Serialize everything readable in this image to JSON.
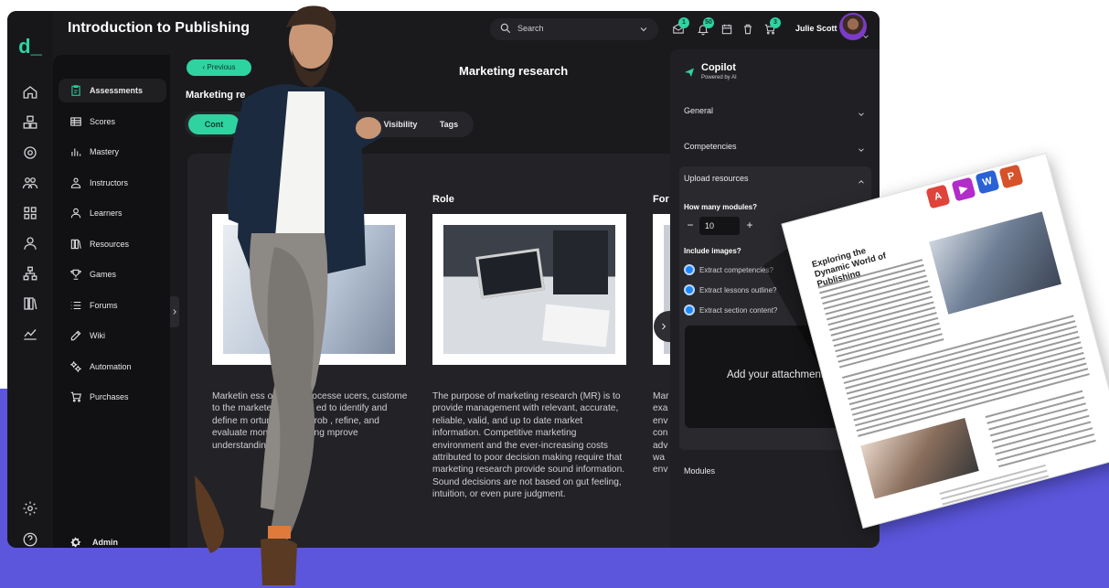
{
  "app": {
    "title": "Introduction to Publishing",
    "logo_glyph": "d_"
  },
  "topbar": {
    "search_placeholder": "Search",
    "badges": {
      "messages": "1",
      "notifications": "50",
      "cart": "3"
    },
    "user_name": "Julie Scott"
  },
  "sidebar": {
    "items": [
      {
        "label": "Assessments",
        "icon": "clipboard-icon",
        "active": true
      },
      {
        "label": "Scores",
        "icon": "table-icon"
      },
      {
        "label": "Mastery",
        "icon": "bar-chart-icon"
      },
      {
        "label": "Instructors",
        "icon": "instructor-icon"
      },
      {
        "label": "Learners",
        "icon": "person-icon"
      },
      {
        "label": "Resources",
        "icon": "books-icon"
      },
      {
        "label": "Games",
        "icon": "trophy-icon"
      },
      {
        "label": "Forums",
        "icon": "list-icon"
      },
      {
        "label": "Wiki",
        "icon": "edit-icon"
      },
      {
        "label": "Automation",
        "icon": "automation-icon"
      },
      {
        "label": "Purchases",
        "icon": "cart-icon"
      }
    ],
    "admin_label": "Admin"
  },
  "main": {
    "previous_label": "Previous",
    "page_title": "Marketing research",
    "subheading": "Marketing re",
    "tabs": [
      {
        "label": "Cont",
        "active": true
      },
      {
        "label": "Visibility"
      },
      {
        "label": "Tags"
      }
    ],
    "cards": [
      {
        "heading": "",
        "text": "Marketin                    ess or set of processe                   ucers, custome                    to the marketer through i                  ed to identify and define m                 ortunities and prob                    , refine, and evaluate                      monitor marketing                       mprove understanding of                      ess."
      },
      {
        "heading": "Role",
        "text": "The purpose of marketing research (MR) is to provide management with relevant, accurate, reliable, valid, and up to date market information. Competitive marketing environment and the ever-increasing costs attributed to poor decision making require that marketing research provide sound information. Sound decisions are not based on gut feeling, intuition, or even pure judgment."
      },
      {
        "heading": "For",
        "text": "Mar exa env con adv wa env"
      }
    ]
  },
  "copilot": {
    "title": "Copilot",
    "subtitle": "Powered by AI",
    "sections": {
      "general": "General",
      "competencies": "Competencies",
      "upload": "Upload resources",
      "modules": "Modules"
    },
    "modules_question": "How many modules?",
    "modules_value": "10",
    "images_question": "Include images?",
    "options": [
      "Extract competencies?",
      "Extract lessons outline?",
      "Extract section content?"
    ],
    "attach_label": "Add your attachment"
  },
  "floating_doc": {
    "title_line1": "Exploring the",
    "title_line2": "Dynamic World of Publishing",
    "app_icons": [
      {
        "letter": "A",
        "name": "pdf-icon",
        "color": "#e0433a"
      },
      {
        "letter": "▶",
        "name": "stream-icon",
        "color": "#b22cc9"
      },
      {
        "letter": "W",
        "name": "word-icon",
        "color": "#2a62d6"
      },
      {
        "letter": "P",
        "name": "powerpoint-icon",
        "color": "#d6522a"
      }
    ]
  },
  "colors": {
    "accent": "#2ed3a0",
    "background_band": "#5b56db",
    "app_bg": "#1a1a1d"
  }
}
